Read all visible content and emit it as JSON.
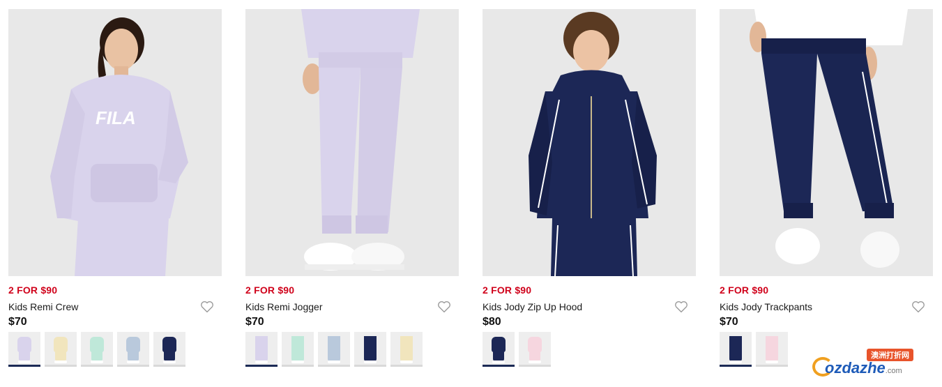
{
  "products": [
    {
      "promo": "2 FOR $90",
      "name": "Kids Remi Crew",
      "price": "$70",
      "image": "girl-in-lilac-fila-sweatshirt",
      "swatches": [
        {
          "color": "#d9d3ec",
          "active": true
        },
        {
          "color": "#f1e5bd",
          "active": false
        },
        {
          "color": "#bfe8d9",
          "active": false
        },
        {
          "color": "#b9c9dc",
          "active": false
        },
        {
          "color": "#1c2756",
          "active": false
        }
      ]
    },
    {
      "promo": "2 FOR $90",
      "name": "Kids Remi Jogger",
      "price": "$70",
      "image": "lilac-joggers-white-sneakers",
      "swatches": [
        {
          "color": "#d9d3ec",
          "active": true
        },
        {
          "color": "#bfe8d9",
          "active": false
        },
        {
          "color": "#b9c9dc",
          "active": false
        },
        {
          "color": "#1c2756",
          "active": false
        },
        {
          "color": "#f1e5bd",
          "active": false
        }
      ]
    },
    {
      "promo": "2 FOR $90",
      "name": "Kids Jody Zip Up Hood",
      "price": "$80",
      "image": "boy-in-navy-velour-zip-hood",
      "swatches": [
        {
          "color": "#1c2756",
          "active": true
        },
        {
          "color": "#f6d6df",
          "active": false
        }
      ]
    },
    {
      "promo": "2 FOR $90",
      "name": "Kids Jody Trackpants",
      "price": "$70",
      "image": "navy-velour-trackpants",
      "swatches": [
        {
          "color": "#1c2756",
          "active": true
        },
        {
          "color": "#f6d6df",
          "active": false
        }
      ]
    }
  ],
  "icons": {
    "wishlist": "heart-outline-icon"
  },
  "watermark": {
    "badge": "澳洲打折网",
    "text": "ozdazhe",
    "suffix": ".com"
  },
  "colors": {
    "promo": "#d0021b",
    "navy": "#1c2a55"
  }
}
